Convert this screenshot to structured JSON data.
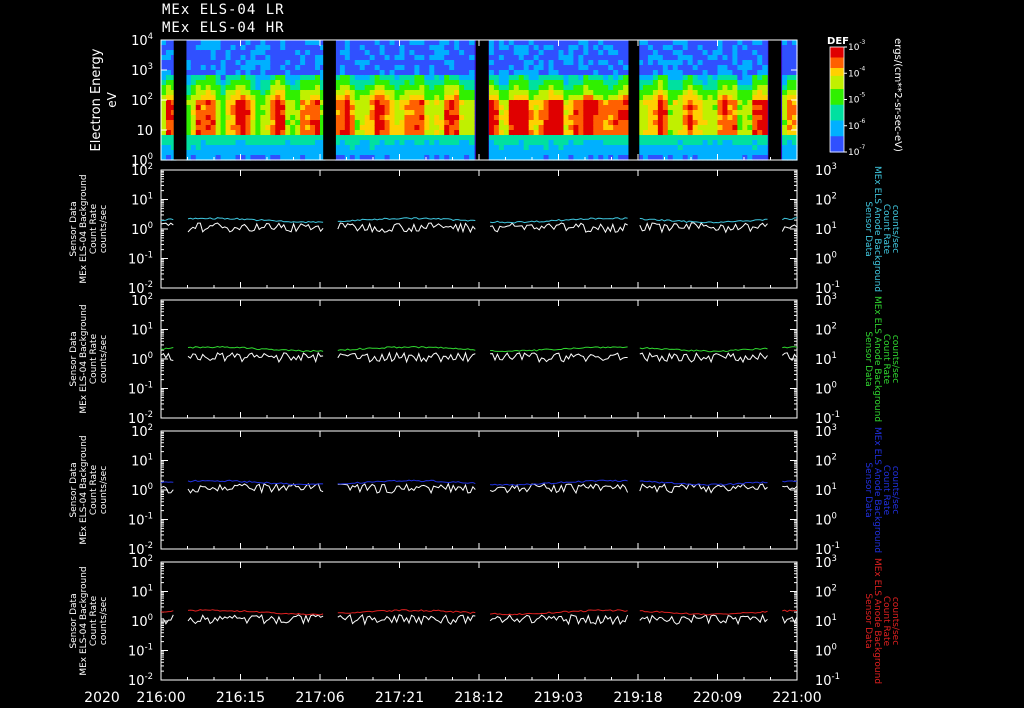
{
  "header": {
    "title_line1": "MEx ELS-04 LR",
    "title_line2": "MEx ELS-04 HR"
  },
  "colors": {
    "background": "#000000",
    "axis": "#ffffff",
    "panel1_series": "#40c8e0",
    "panel2_series": "#30d830",
    "panel3_series": "#2030e0",
    "panel4_series": "#e02020",
    "background_counts": "#ffffff"
  },
  "chart_data": [
    {
      "type": "heatmap",
      "ylabel": "Electron Energy",
      "yunit": "eV",
      "yscale": "log",
      "ylim": [
        1,
        10000
      ],
      "y_ticks": [
        "10",
        "10",
        "10",
        "10",
        "10"
      ],
      "y_tick_exponents": [
        "0",
        "",
        "2",
        "3",
        "4"
      ],
      "y_tick_labels": [
        "10^0",
        "10",
        "10^2",
        "10^3",
        "10^4"
      ],
      "colorbar": {
        "title": "DEF",
        "unit_label": "ergs/(cm**2-sr-sec-eV)",
        "ticks": [
          "10^-7",
          "10^-6",
          "10^-5",
          "10^-4",
          "10^-3"
        ]
      },
      "data_gaps_x": [
        [
          0.02,
          0.04
        ],
        [
          0.255,
          0.275
        ],
        [
          0.495,
          0.515
        ],
        [
          0.735,
          0.752
        ],
        [
          0.955,
          0.975
        ]
      ]
    },
    {
      "type": "line",
      "left_axis_label": [
        "Sensor Data",
        "MEx ELS-04 Background",
        "Count Rate",
        "counts/sec"
      ],
      "right_axis_label": [
        "Sensor Data",
        "MEx ELS Anode Background",
        "Count Rate",
        "counts/sec"
      ],
      "yscale": "log",
      "ylim_left": [
        0.01,
        100
      ],
      "ylim_right": [
        0.1,
        1000
      ],
      "left_ticks": [
        "10^-2",
        "10^-1",
        "10^0",
        "10^1",
        "10^2"
      ],
      "right_ticks": [
        "10^-1",
        "10^0",
        "10^1",
        "10^2",
        "10^3"
      ],
      "series_level_right": 20,
      "background_level_left": 1.2,
      "color": "#40c8e0"
    },
    {
      "type": "line",
      "left_axis_label": [
        "Sensor Data",
        "MEx ELS-04 Background",
        "Count Rate",
        "counts/sec"
      ],
      "right_axis_label": [
        "Sensor Data",
        "MEx ELS Anode Background",
        "Count Rate",
        "counts/sec"
      ],
      "yscale": "log",
      "ylim_left": [
        0.01,
        100
      ],
      "ylim_right": [
        0.1,
        1000
      ],
      "left_ticks": [
        "10^-2",
        "10^-1",
        "10^0",
        "10^1",
        "10^2"
      ],
      "right_ticks": [
        "10^-1",
        "10^0",
        "10^1",
        "10^2",
        "10^3"
      ],
      "series_level_right": 22,
      "background_level_left": 1.2,
      "color": "#30d830"
    },
    {
      "type": "line",
      "left_axis_label": [
        "Sensor Data",
        "MEx ELS-04 Background",
        "Count Rate",
        "counts/sec"
      ],
      "right_axis_label": [
        "Sensor Data",
        "MEx ELS Anode Background",
        "Count Rate",
        "counts/sec"
      ],
      "yscale": "log",
      "ylim_left": [
        0.01,
        100
      ],
      "ylim_right": [
        0.1,
        1000
      ],
      "left_ticks": [
        "10^-2",
        "10^-1",
        "10^0",
        "10^1",
        "10^2"
      ],
      "right_ticks": [
        "10^-1",
        "10^0",
        "10^1",
        "10^2",
        "10^3"
      ],
      "series_level_right": 18,
      "background_level_left": 1.2,
      "color": "#2030e0"
    },
    {
      "type": "line",
      "left_axis_label": [
        "Sensor Data",
        "MEx ELS-04 Background",
        "Count Rate",
        "counts/sec"
      ],
      "right_axis_label": [
        "Sensor Data",
        "MEx ELS Anode Background",
        "Count Rate",
        "counts/sec"
      ],
      "yscale": "log",
      "ylim_left": [
        0.01,
        100
      ],
      "ylim_right": [
        0.1,
        1000
      ],
      "left_ticks": [
        "10^-2",
        "10^-1",
        "10^0",
        "10^1",
        "10^2"
      ],
      "right_ticks": [
        "10^-1",
        "10^0",
        "10^1",
        "10^2",
        "10^3"
      ],
      "series_level_right": 20,
      "background_level_left": 1.2,
      "color": "#e02020"
    }
  ],
  "x_axis": {
    "year": "2020",
    "tick_labels": [
      "216:00",
      "216:15",
      "217:06",
      "217:21",
      "218:12",
      "219:03",
      "219:18",
      "220:09",
      "221:00"
    ]
  }
}
